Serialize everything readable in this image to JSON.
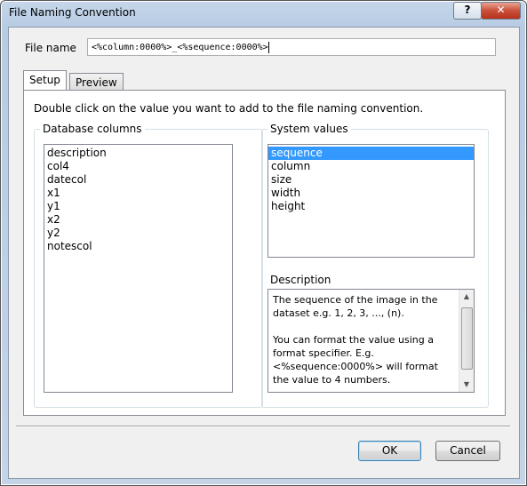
{
  "window": {
    "title": "File Naming Convention",
    "help_glyph": "?",
    "close_glyph": "✕"
  },
  "file_name": {
    "label": "File name",
    "value": "<%column:0000%>_<%sequence:0000%>"
  },
  "tabs": [
    {
      "label": "Setup",
      "active": true
    },
    {
      "label": "Preview",
      "active": false
    }
  ],
  "setup": {
    "instruction": "Double click on the value you want to add to the file naming convention.",
    "database_columns": {
      "label": "Database columns",
      "items": [
        "description",
        "col4",
        "datecol",
        "x1",
        "y1",
        "x2",
        "y2",
        "notescol"
      ]
    },
    "system_values": {
      "label": "System values",
      "items": [
        "sequence",
        "column",
        "size",
        "width",
        "height"
      ],
      "selected": "sequence"
    },
    "description": {
      "label": "Description",
      "lines": [
        "The sequence of the image in the dataset e.g. 1, 2, 3, ..., (n).",
        "You can format the value using a format specifier.  E.g. <%sequence:0000%> will format the value to 4 numbers."
      ]
    }
  },
  "buttons": {
    "ok": "OK",
    "cancel": "Cancel"
  }
}
